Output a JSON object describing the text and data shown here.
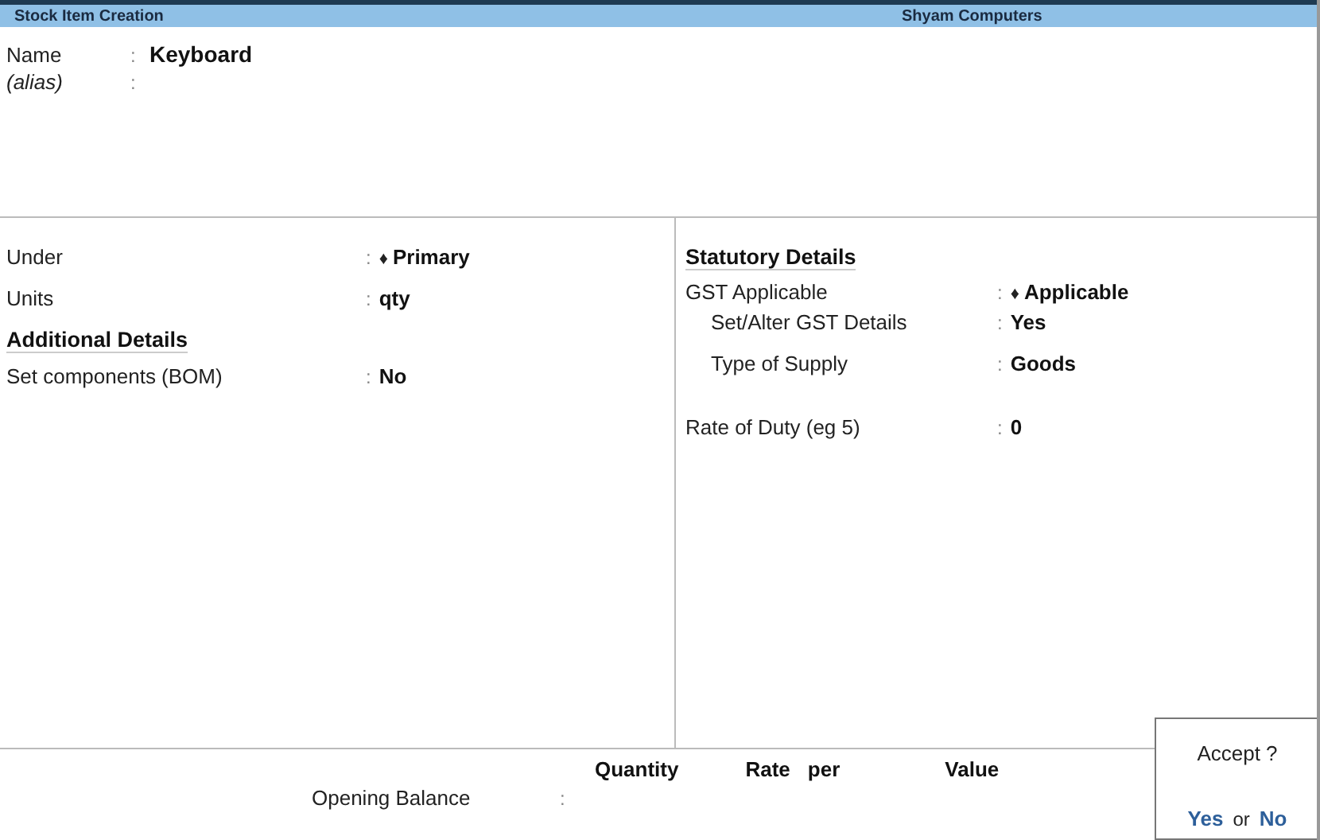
{
  "title_bar": {
    "title": "Stock Item Creation",
    "company": "Shyam Computers"
  },
  "header_fields": [
    {
      "label": "Name",
      "italic": false,
      "colon": ":",
      "value": "Keyboard"
    },
    {
      "label": "(alias)",
      "italic": true,
      "colon": ":"
    }
  ],
  "left_fields": [
    {
      "kind": "field",
      "label": "Under",
      "colon": ":",
      "marker": "♦",
      "value": "Primary"
    },
    {
      "kind": "field",
      "label": "Units",
      "colon": ":",
      "value": "qty"
    },
    {
      "kind": "heading",
      "label": "Additional Details"
    },
    {
      "kind": "field",
      "label": "Set components (BOM)",
      "colon": ":",
      "value": "No"
    }
  ],
  "right_fields": [
    {
      "kind": "heading",
      "label": "Statutory Details"
    },
    {
      "kind": "field",
      "label": "GST Applicable",
      "colon": ":",
      "marker": "♦",
      "value": "Applicable"
    },
    {
      "kind": "subfield",
      "label": "Set/Alter GST Details",
      "colon": ":",
      "value": "Yes"
    },
    {
      "kind": "subfield",
      "label": "Type of Supply",
      "colon": ":",
      "value": "Goods"
    },
    {
      "kind": "field",
      "label": "Rate of Duty (eg 5)",
      "colon": ":",
      "value": "0"
    }
  ],
  "opening_balance": {
    "columns": [
      "Quantity",
      "Rate",
      "per",
      "Value"
    ],
    "label": "Opening Balance",
    "colon": ":"
  },
  "accept_dialog": {
    "question": "Accept ?",
    "yes": "Yes",
    "or": "or",
    "no": "No"
  }
}
